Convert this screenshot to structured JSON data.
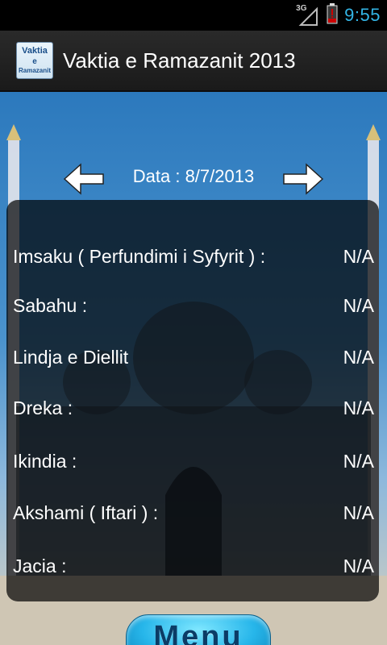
{
  "status_bar": {
    "network_type": "3G",
    "time": "9:55"
  },
  "action_bar": {
    "title": "Vaktia e Ramazanit 2013",
    "icon": {
      "line1": "Vaktia",
      "line2": "e",
      "line3": "Ramazanit"
    }
  },
  "date": {
    "label": "Data : 8/7/2013"
  },
  "prayer_times": [
    {
      "name": "Imsaku ( Perfundimi i Syfyrit ) :",
      "value": "N/A"
    },
    {
      "name": "Sabahu :",
      "value": "N/A"
    },
    {
      "name": "Lindja e Diellit",
      "value": "N/A"
    },
    {
      "name": "Dreka :",
      "value": "N/A"
    },
    {
      "name": "Ikindia :",
      "value": "N/A"
    },
    {
      "name": "Akshami ( Iftari ) :",
      "value": "N/A"
    },
    {
      "name": "Jacia :",
      "value": "N/A"
    }
  ],
  "menu_button": {
    "label": "Menu"
  },
  "icons": {
    "previous": "arrow-left-icon",
    "next": "arrow-right-icon",
    "signal": "signal-icon",
    "battery": "battery-low-icon"
  },
  "colors": {
    "accent": "#33b5e5",
    "battery_alert": "#cc0000",
    "menu_button": "#27b6ea"
  }
}
